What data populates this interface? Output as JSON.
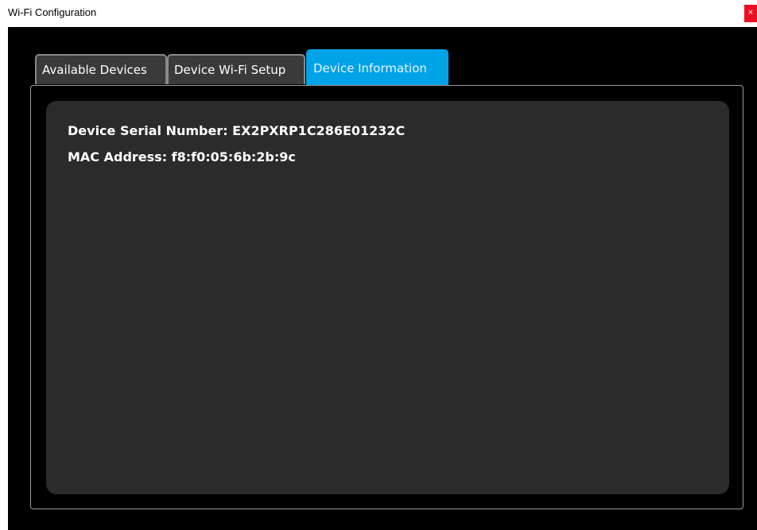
{
  "window": {
    "title": "Wi-Fi Configuration",
    "close_label": "×"
  },
  "tabs": [
    {
      "label": "Available Devices",
      "active": false
    },
    {
      "label": "Device Wi-Fi Setup",
      "active": false
    },
    {
      "label": "Device Information",
      "active": true
    }
  ],
  "device_info": {
    "serial_line": "Device Serial Number: EX2PXRP1C286E01232C",
    "mac_line": "MAC Address: f8:f0:05:6b:2b:9c"
  },
  "colors": {
    "active_tab": "#00a2e8",
    "inactive_tab": "#3a3a3a",
    "background": "#000000",
    "card": "#2b2b2b",
    "close_button": "#e81123"
  }
}
